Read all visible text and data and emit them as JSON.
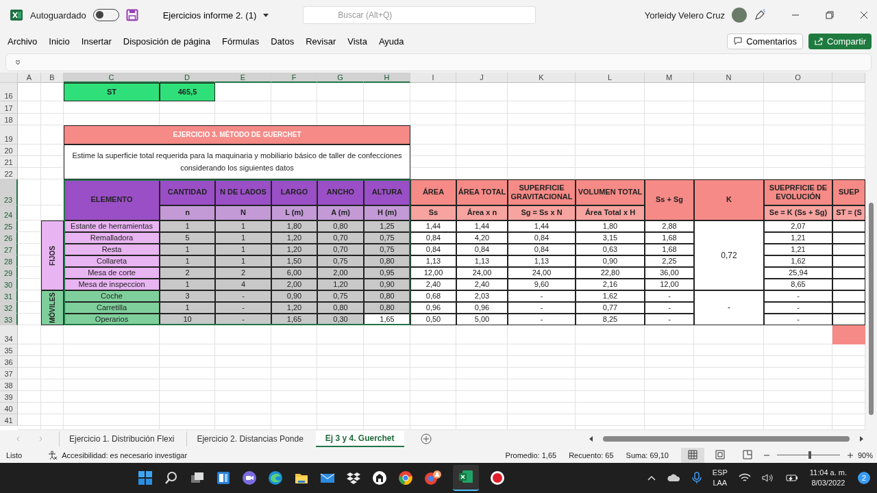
{
  "window": {
    "autosave_label": "Autoguardado",
    "autosave_on": false,
    "title": "Ejercicios informe 2.  (1)",
    "search_placeholder": "Buscar (Alt+Q)",
    "user": "Yorleidy Velero Cruz"
  },
  "menu": [
    "Archivo",
    "Inicio",
    "Insertar",
    "Disposición de página",
    "Fórmulas",
    "Datos",
    "Revisar",
    "Vista",
    "Ayuda"
  ],
  "actions": {
    "comments": "Comentarios",
    "share": "Compartir"
  },
  "sheet": {
    "columns": [
      {
        "label": "A",
        "selected": false
      },
      {
        "label": "B",
        "selected": false
      },
      {
        "label": "C",
        "selected": true
      },
      {
        "label": "D",
        "selected": true
      },
      {
        "label": "E",
        "selected": true
      },
      {
        "label": "F",
        "selected": true
      },
      {
        "label": "G",
        "selected": true
      },
      {
        "label": "H",
        "selected": true
      },
      {
        "label": "I",
        "selected": false
      },
      {
        "label": "J",
        "selected": false
      },
      {
        "label": "K",
        "selected": false
      },
      {
        "label": "L",
        "selected": false
      },
      {
        "label": "M",
        "selected": false
      },
      {
        "label": "N",
        "selected": false
      },
      {
        "label": "O",
        "selected": false
      }
    ],
    "rows": [
      {
        "label": "16",
        "selected": false
      },
      {
        "label": "17",
        "selected": false
      },
      {
        "label": "18",
        "selected": false
      },
      {
        "label": "19",
        "selected": false
      },
      {
        "label": "20",
        "selected": false
      },
      {
        "label": "21",
        "selected": false
      },
      {
        "label": "22",
        "selected": false
      },
      {
        "label": "23",
        "selected": true
      },
      {
        "label": "24",
        "selected": true
      },
      {
        "label": "25",
        "selected": true
      },
      {
        "label": "26",
        "selected": true
      },
      {
        "label": "27",
        "selected": true
      },
      {
        "label": "28",
        "selected": true
      },
      {
        "label": "29",
        "selected": true
      },
      {
        "label": "30",
        "selected": true
      },
      {
        "label": "31",
        "selected": true
      },
      {
        "label": "32",
        "selected": true
      },
      {
        "label": "33",
        "selected": true
      },
      {
        "label": "34",
        "selected": false
      },
      {
        "label": "35",
        "selected": false
      },
      {
        "label": "36",
        "selected": false
      },
      {
        "label": "37",
        "selected": false
      },
      {
        "label": "38",
        "selected": false
      },
      {
        "label": "39",
        "selected": false
      },
      {
        "label": "40",
        "selected": false
      },
      {
        "label": "41",
        "selected": false
      }
    ],
    "summary": {
      "label": "ST",
      "value": "465,5"
    },
    "exercise_title": "EJERCICIO 3. MÉTODO DE GUERCHET",
    "description": "Estime la superficie total requerida para la maquinaria y mobiliario básico de taller de confecciones considerando los siguientes datos",
    "table": {
      "headers": [
        {
          "title": "ELEMENTO",
          "kind": "input"
        },
        {
          "title": "CANTIDAD",
          "sub": "n",
          "kind": "input"
        },
        {
          "title": "N DE LADOS",
          "sub": "N",
          "kind": "input"
        },
        {
          "title": "LARGO",
          "sub": "L (m)",
          "kind": "input"
        },
        {
          "title": "ANCHO",
          "sub": "A (m)",
          "kind": "input"
        },
        {
          "title": "ALTURA",
          "sub": "H (m)",
          "kind": "input"
        },
        {
          "title": "ÁREA",
          "sub": "Ss",
          "kind": "calc"
        },
        {
          "title": "ÁREA TOTAL",
          "sub": "Área x n",
          "kind": "calc"
        },
        {
          "title": "SUPERFICIE GRAVITACIONAL",
          "sub": "Sg = Ss x N",
          "kind": "calc"
        },
        {
          "title": "VOLUMEN TOTAL",
          "sub": "Área Total x H",
          "kind": "calc"
        },
        {
          "title": "Ss + Sg",
          "kind": "calc"
        },
        {
          "title": "K",
          "kind": "calc"
        },
        {
          "title": "SUEPRFICIE DE EVOLUCIÓN",
          "sub": "Se = K (Ss + Sg)",
          "kind": "calc"
        },
        {
          "title": "SUEP",
          "sub": "ST = (S",
          "kind": "calc"
        }
      ],
      "groups": [
        {
          "label": "FIJOS",
          "color": "#e8b4f2",
          "k": "0,72",
          "rows": [
            {
              "name": "Estante de herramientas",
              "inputs": [
                "1",
                "1",
                "1,80",
                "0,80",
                "1,25"
              ],
              "results": [
                "1,44",
                "1,44",
                "1,44",
                "1,80",
                "2,88",
                "2,07"
              ],
              "active": false
            },
            {
              "name": "Remalladora",
              "inputs": [
                "5",
                "1",
                "1,20",
                "0,70",
                "0,75"
              ],
              "results": [
                "0,84",
                "4,20",
                "0,84",
                "3,15",
                "1,68",
                "1,21"
              ],
              "active": false
            },
            {
              "name": "Resta",
              "inputs": [
                "1",
                "1",
                "1,20",
                "0,70",
                "0,75"
              ],
              "results": [
                "0,84",
                "0,84",
                "0,84",
                "0,63",
                "1,68",
                "1,21"
              ],
              "active": false
            },
            {
              "name": "Collareta",
              "inputs": [
                "1",
                "1",
                "1,50",
                "0,75",
                "0,80"
              ],
              "results": [
                "1,13",
                "1,13",
                "1,13",
                "0,90",
                "2,25",
                "1,62"
              ],
              "active": false
            },
            {
              "name": "Mesa de corte",
              "inputs": [
                "2",
                "2",
                "6,00",
                "2,00",
                "0,95"
              ],
              "results": [
                "12,00",
                "24,00",
                "24,00",
                "22,80",
                "36,00",
                "25,94"
              ],
              "active": false
            },
            {
              "name": "Mesa de inspeccion",
              "inputs": [
                "1",
                "4",
                "2,00",
                "1,20",
                "0,90"
              ],
              "results": [
                "2,40",
                "2,40",
                "9,60",
                "2,16",
                "12,00",
                "8,65"
              ],
              "active": false
            }
          ]
        },
        {
          "label": "MÓVILES",
          "color": "#7fcf9c",
          "k": "-",
          "rows": [
            {
              "name": "Coche",
              "inputs": [
                "3",
                "-",
                "0,90",
                "0,75",
                "0,80"
              ],
              "results": [
                "0,68",
                "2,03",
                "-",
                "1,62",
                "-",
                "-"
              ],
              "active": false
            },
            {
              "name": "Carretilla",
              "inputs": [
                "1",
                "-",
                "1,20",
                "0,80",
                "0,80"
              ],
              "results": [
                "0,96",
                "0,96",
                "-",
                "0,77",
                "-",
                "-"
              ],
              "active": false
            },
            {
              "name": "Operarios",
              "inputs": [
                "10",
                "-",
                "1,65",
                "0,30",
                "1,65"
              ],
              "results": [
                "0,50",
                "5,00",
                "-",
                "8,25",
                "-",
                "-"
              ],
              "active": true
            }
          ]
        }
      ]
    }
  },
  "sheet_tabs": [
    {
      "label": "Ejercicio 1. Distribución Flexi",
      "selected": false
    },
    {
      "label": "Ejercicio 2. Distancias Ponde",
      "selected": false
    },
    {
      "label": "Ej 3 y 4. Guerchet",
      "selected": true
    }
  ],
  "status_bar": {
    "ready": "Listo",
    "accessibility": "Accesibilidad: es necesario investigar",
    "average": "Promedio: 1,65",
    "count": "Recuento: 65",
    "sum": "Suma: 69,10",
    "zoom_slider": {
      "level": 0.52
    },
    "zoom": "90%"
  },
  "taskbar": {
    "language": "ESP",
    "layout": "LAA",
    "time": "11:04 a. m.",
    "date": "8/03/2022",
    "notifications": "2"
  }
}
